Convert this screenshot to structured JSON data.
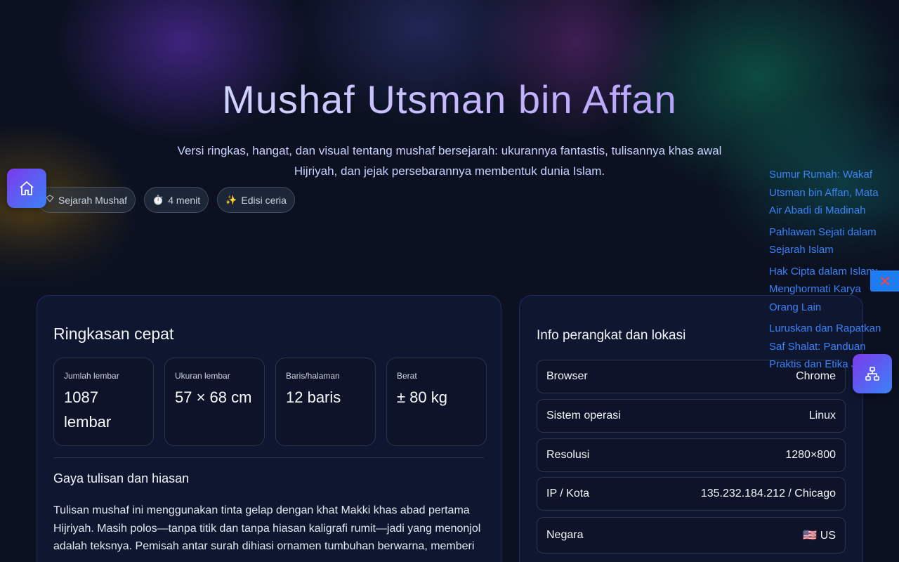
{
  "hero": {
    "title": "Mushaf Utsman bin Affan",
    "subtitle": "Versi ringkas, hangat, dan visual tentang mushaf bersejarah: ukurannya fantastis, tulisannya khas awal Hijriyah, dan jejak persebarannya membentuk dunia Islam."
  },
  "chips": [
    {
      "icon": "",
      "label": "Sejarah Mushaf"
    },
    {
      "icon": "⏱️",
      "label": "4 menit"
    },
    {
      "icon": "✨",
      "label": "Edisi ceria"
    }
  ],
  "summary": {
    "title": "Ringkasan cepat",
    "stats": [
      {
        "label": "Jumlah lembar",
        "value": "1087 lembar"
      },
      {
        "label": "Ukuran lembar",
        "value": "57 × 68 cm"
      },
      {
        "label": "Baris/halaman",
        "value": "12 baris"
      },
      {
        "label": "Berat",
        "value": "± 80 kg"
      }
    ],
    "section_title": "Gaya tulisan dan hiasan",
    "section_text": "Tulisan mushaf ini menggunakan tinta gelap dengan khat Makki khas abad pertama Hijriyah. Masih polos—tanpa titik dan tanpa hiasan kaligrafi rumit—jadi yang menonjol adalah teksnya. Pemisah antar surah dihiasi ornamen tumbuhan berwarna, memberi"
  },
  "device_info": {
    "title": "Info perangkat dan lokasi",
    "rows": [
      {
        "label": "Browser",
        "value": "Chrome"
      },
      {
        "label": "Sistem operasi",
        "value": "Linux"
      },
      {
        "label": "Resolusi",
        "value": "1280×800"
      },
      {
        "label": "IP / Kota",
        "value": "135.232.184.212 / Chicago"
      },
      {
        "label": "Negara",
        "value": "🇺🇸 US"
      }
    ]
  },
  "related_links": [
    "Sumur Rumah: Wakaf Utsman bin Affan, Mata Air Abadi di Madinah",
    "Pahlawan Sejati dalam Sejarah Islam",
    "Hak Cipta dalam Islam: Menghormati Karya Orang Lain",
    "Luruskan dan Rapatkan Saf Shalat: Panduan Praktis dan Etika Jamaah"
  ],
  "icons": {
    "home": "home-icon",
    "close": "close-icon",
    "sitemap": "sitemap-icon",
    "chip0": "tag-icon"
  },
  "colors": {
    "background": "#0b1120",
    "card": "#0f1730",
    "link": "#3b82f6",
    "accent_start": "#7c3aed",
    "accent_end": "#3b82f6",
    "close": "#ef4444"
  }
}
